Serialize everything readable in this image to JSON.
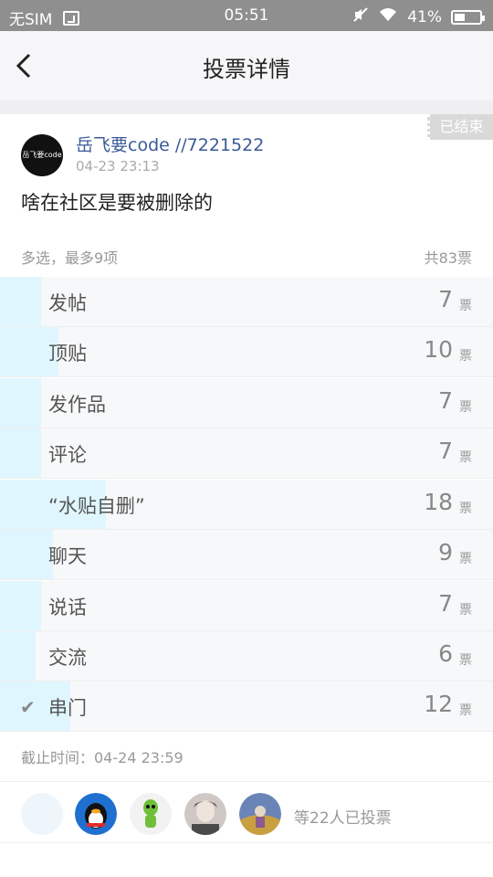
{
  "status_bar": {
    "carrier": "无SIM",
    "time": "05:51",
    "battery": "41%",
    "battery_level": 0.41
  },
  "nav": {
    "title": "投票详情"
  },
  "post": {
    "badge": "已结束",
    "avatar_text": "岳飞要code",
    "author": "岳飞要code //7221522",
    "time": "04-23 23:13",
    "question": "啥在社区是要被删除的"
  },
  "vote_meta": {
    "mode": "多选，最多9项",
    "total": "共83票"
  },
  "options": [
    {
      "label": "发帖",
      "count": "7",
      "unit": "票",
      "votes": 7,
      "checked": false
    },
    {
      "label": "顶贴",
      "count": "10",
      "unit": "票",
      "votes": 10,
      "checked": false
    },
    {
      "label": "发作品",
      "count": "7",
      "unit": "票",
      "votes": 7,
      "checked": false
    },
    {
      "label": "评论",
      "count": "7",
      "unit": "票",
      "votes": 7,
      "checked": false
    },
    {
      "label": "“水贴自删”",
      "count": "18",
      "unit": "票",
      "votes": 18,
      "checked": false
    },
    {
      "label": "聊天",
      "count": "9",
      "unit": "票",
      "votes": 9,
      "checked": false
    },
    {
      "label": "说话",
      "count": "7",
      "unit": "票",
      "votes": 7,
      "checked": false
    },
    {
      "label": "交流",
      "count": "6",
      "unit": "票",
      "votes": 6,
      "checked": false
    },
    {
      "label": "串门",
      "count": "12",
      "unit": "票",
      "votes": 12,
      "checked": true
    }
  ],
  "deadline": "截止时间：04-24 23:59",
  "voters": {
    "summary": "等22人已投票",
    "colors": [
      "#eef6fb",
      "#1e6fd0",
      "#8ab848",
      "#9a8e86",
      "#6b84b8"
    ]
  },
  "colors": {
    "accent_bar": "#e0f6fe",
    "author_link": "#3a5a98"
  }
}
